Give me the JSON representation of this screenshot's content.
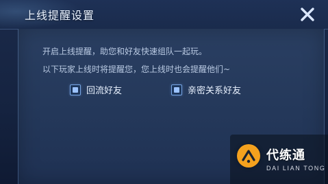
{
  "dialog": {
    "title": "上线提醒设置",
    "description_1": "开启上线提醒，助您和好友快速组队一起玩。",
    "description_2": "以下玩家上线时将提醒您，您上线时也会提醒他们~"
  },
  "options": [
    {
      "label": "回流好友",
      "checked": true
    },
    {
      "label": "亲密关系好友",
      "checked": true
    }
  ],
  "watermark": {
    "main": "代练通",
    "sub": "DAI LIAN TONG",
    "accent": "#f4a11e"
  },
  "icons": {
    "close": "close-icon",
    "checkbox": "checkbox-icon"
  },
  "colors": {
    "title_text": "#e9f2ff",
    "body_text": "#b9c9e2",
    "checkbox_border": "#78a7e6"
  }
}
